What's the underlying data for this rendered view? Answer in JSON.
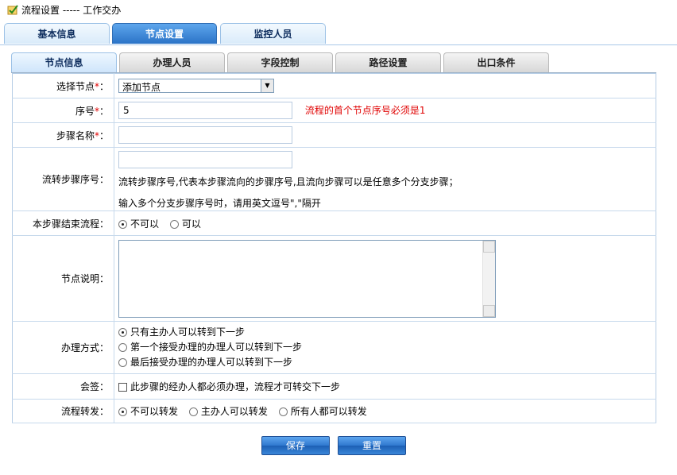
{
  "header": {
    "title": "流程设置 ----- 工作交办"
  },
  "top_tabs": [
    {
      "label": "基本信息",
      "active": false
    },
    {
      "label": "节点设置",
      "active": true
    },
    {
      "label": "监控人员",
      "active": false
    }
  ],
  "sub_tabs": [
    {
      "label": "节点信息",
      "active": true
    },
    {
      "label": "办理人员",
      "active": false
    },
    {
      "label": "字段控制",
      "active": false
    },
    {
      "label": "路径设置",
      "active": false
    },
    {
      "label": "出口条件",
      "active": false
    }
  ],
  "form": {
    "select_node": {
      "label": "选择节点",
      "value": "添加节点"
    },
    "seq_no": {
      "label": "序号",
      "value": "5",
      "hint": "流程的首个节点序号必须是1"
    },
    "step_name": {
      "label": "步骤名称",
      "value": ""
    },
    "next_step": {
      "label": "流转步骤序号：",
      "value": "",
      "desc1": "流转步骤序号,代表本步骤流向的步骤序号,且流向步骤可以是任意多个分支步骤；",
      "desc2": "输入多个分支步骤序号时，请用英文逗号\",\"隔开"
    },
    "can_end": {
      "label": "本步骤结束流程：",
      "options": [
        "不可以",
        "可以"
      ],
      "selected": 0
    },
    "node_desc": {
      "label": "节点说明：",
      "value": ""
    },
    "handle_mode": {
      "label": "办理方式：",
      "options": [
        "只有主办人可以转到下一步",
        "第一个接受办理的办理人可以转到下一步",
        "最后接受办理的办理人可以转到下一步"
      ],
      "selected": 0
    },
    "countersign": {
      "label": "会签：",
      "option": "此步骤的经办人都必须办理，流程才可转交下一步",
      "checked": false
    },
    "forward": {
      "label": "流程转发：",
      "options": [
        "不可以转发",
        "主办人可以转发",
        "所有人都可以转发"
      ],
      "selected": 0
    }
  },
  "buttons": {
    "save": "保存",
    "reset": "重置"
  }
}
